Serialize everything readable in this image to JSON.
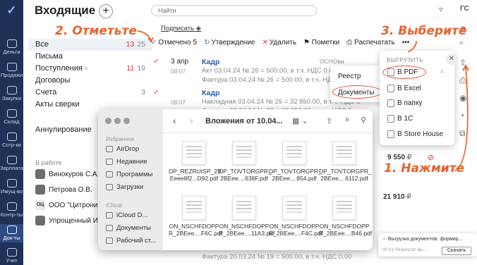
{
  "app": {
    "title": "Входящие",
    "search_placeholder": "Найти",
    "user_badge": "ГС",
    "org": "ОСНОва"
  },
  "leftnav": [
    {
      "label": "Деньги",
      "icon": "ruble-icon"
    },
    {
      "label": "Продажи",
      "icon": "cart-icon"
    },
    {
      "label": "Закупки",
      "icon": "bag-icon"
    },
    {
      "label": "Склад",
      "icon": "warehouse-icon"
    },
    {
      "label": "Сотр-ки",
      "icon": "people-icon"
    },
    {
      "label": "Зарплата",
      "icon": "wallet-icon"
    },
    {
      "label": "Имущ-во",
      "icon": "building-icon"
    },
    {
      "label": "Контр-ты",
      "icon": "contacts-icon"
    },
    {
      "label": "Док-ты",
      "icon": "send-icon"
    },
    {
      "label": "Учет",
      "icon": "ledger-icon"
    }
  ],
  "folders": [
    {
      "label": "Все",
      "red": "13",
      "count": "25"
    },
    {
      "label": "Письма",
      "red": "",
      "count": ""
    },
    {
      "label": "Поступления",
      "red": "11",
      "count": "19"
    },
    {
      "label": "Договоры",
      "red": "",
      "count": ""
    },
    {
      "label": "Счета",
      "red": "",
      "count": "3"
    },
    {
      "label": "Акты сверки",
      "red": "",
      "count": ""
    },
    {
      "label": "Аннулирование",
      "red": "",
      "count": ""
    }
  ],
  "in_work_label": "В работе",
  "people": [
    {
      "name": "Винокуров С.А."
    },
    {
      "name": "Петрова О.В."
    },
    {
      "name": "ООО \"Цитроник"
    },
    {
      "name": "Упрощенный И."
    }
  ],
  "oc_badge": "ОЦ",
  "subscribe": "Подписать",
  "toolbar": {
    "marked": "Отмечено 5",
    "approve": "Утверждение",
    "delete": "Удалить",
    "notes": "Пометки",
    "print": "Распечатать",
    "more": "•••"
  },
  "rows": [
    {
      "date": "3 апр",
      "time": "08:07",
      "cp": "Кадр",
      "l1": "Акт 03.04.24 № 26 = 500.00, в т.ч. НДС 0.00",
      "l2": "Фактура 03.04.24 № 26 = 500.00, в т.ч. НДС 0.00"
    },
    {
      "date": "",
      "time": "08:07",
      "cp": "Кадр",
      "l1": "Накладная 03.04.24 № 25 = 32 850.00, в т.ч. НДС 5",
      "l2": "Фактура 03.04.24 № 25 = 32 850.00, в т.ч. НДС 5"
    }
  ],
  "amounts": {
    "a1": "9 550",
    "a1_unit": "₽",
    "a2": "21 910",
    "a2_unit": "₽"
  },
  "bottom_line": "Фактура 20.03.24 № 19 = 500.00, в т.ч. НДС 0.00",
  "finder": {
    "title": "Вложения от 10.04...",
    "favorites_label": "Избранное",
    "favorites": [
      "AirDrop",
      "Недавние",
      "Программы",
      "Загрузки"
    ],
    "icloud_label": "iCloud",
    "icloud": [
      "iCloud D...",
      "Документы",
      "Рабочий ст..."
    ],
    "files": [
      {
        "l1": "DP_REZRUISP_2B",
        "l2": "Eeee8f2...D92.pdf"
      },
      {
        "l1": "DP_TOVTORGPR_",
        "l2": "2BEee....638F.pdf"
      },
      {
        "l1": "DP_TOVTORGPR_",
        "l2": "2BEee....854.pdf"
      },
      {
        "l1": "DP_TOVTORGPR_",
        "l2": "2BEee....6112.pdf"
      },
      {
        "l1": "ON_NSCHFDOPP",
        "l2": "R_2BEee....F6C.pdf"
      },
      {
        "l1": "ON_NSCHFDOPP",
        "l2": "R_2BEee....11A3.pdf"
      },
      {
        "l1": "ON_NSCHFDOPP",
        "l2": "R_2BEee....F4C.pdf"
      },
      {
        "l1": "ON_NSCHFDOPP",
        "l2": "R_2BEee....B46.pdf"
      }
    ]
  },
  "menu1": {
    "registry": "Реестр",
    "documents": "Документы"
  },
  "menu2": {
    "header": "ВЫГРУЗИТЬ",
    "items": [
      "В PDF",
      "В Excel",
      "В папку",
      "В 1С",
      "В Store House"
    ]
  },
  "toast": {
    "title": "Выгрузка документов: формир...",
    "time": "00:01",
    "status": "Результат вы...",
    "button": "Скачать"
  },
  "hints": {
    "step1": "1. Нажмите",
    "step2": "2. Отметьте",
    "step3": "3. Выберите"
  },
  "colors": {
    "accent_red": "#d23b3b",
    "hint_orange": "#e8622c",
    "nav_bg": "#1f3156"
  }
}
